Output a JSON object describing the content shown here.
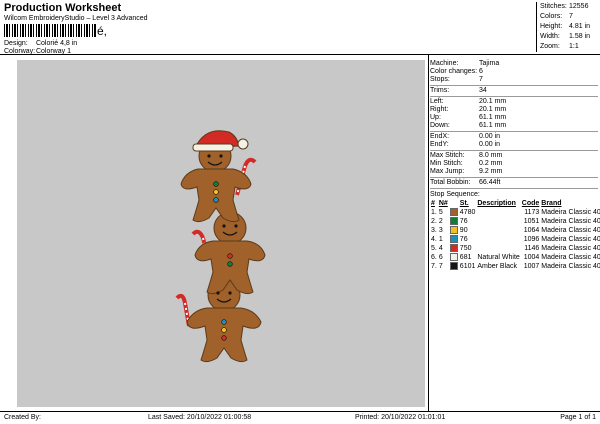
{
  "header": {
    "title": "Production Worksheet",
    "subtitle": "Wilcom EmbroideryStudio – Level 3 Advanced",
    "barcode_tail": "é,",
    "design_label": "Design:",
    "design_value": "Colorié 4,8 in",
    "colorway_label": "Colorway:",
    "colorway_value": "Colorway 1"
  },
  "stats": [
    {
      "k": "Stitches:",
      "v": "12556"
    },
    {
      "k": "Colors:",
      "v": "7"
    },
    {
      "k": "Height:",
      "v": "4.81 in"
    },
    {
      "k": "Width:",
      "v": "1.58 in"
    },
    {
      "k": "Zoom:",
      "v": "1:1"
    }
  ],
  "machine_info": [
    {
      "k": "Machine:",
      "v": "Tajima"
    },
    {
      "k": "Color changes:",
      "v": "6"
    },
    {
      "k": "Stops:",
      "v": "7"
    },
    {
      "k": "Trims:",
      "v": "34"
    },
    {
      "k": "Left:",
      "v": "20.1 mm"
    },
    {
      "k": "Right:",
      "v": "20.1 mm"
    },
    {
      "k": "Up:",
      "v": "61.1 mm"
    },
    {
      "k": "Down:",
      "v": "61.1 mm"
    },
    {
      "k": "EndX:",
      "v": "0.00 in"
    },
    {
      "k": "EndY:",
      "v": "0.00 in"
    },
    {
      "k": "Max Stitch:",
      "v": "8.0 mm"
    },
    {
      "k": "Min Stitch:",
      "v": "0.2 mm"
    },
    {
      "k": "Max Jump:",
      "v": "9.2 mm"
    },
    {
      "k": "Total Bobbin:",
      "v": "66.44ft"
    }
  ],
  "stop_sequence": {
    "title": "Stop Sequence:",
    "headers": [
      "#",
      "N#",
      "",
      "St.",
      "Description",
      "Code",
      "Brand"
    ],
    "rows": [
      {
        "idx": "1.",
        "n": "5",
        "num": "4780",
        "st": "",
        "desc": "",
        "code": "1173",
        "brand": "Madeira Classic 40",
        "color": "#a0612b"
      },
      {
        "idx": "2.",
        "n": "2",
        "num": "76",
        "st": "",
        "desc": "",
        "code": "1051",
        "brand": "Madeira Classic 40",
        "color": "#0f7d3a"
      },
      {
        "idx": "3.",
        "n": "3",
        "num": "90",
        "st": "",
        "desc": "",
        "code": "1064",
        "brand": "Madeira Classic 40",
        "color": "#f1c21c"
      },
      {
        "idx": "4.",
        "n": "1",
        "num": "76",
        "st": "",
        "desc": "",
        "code": "1096",
        "brand": "Madeira Classic 40",
        "color": "#1e8fb5"
      },
      {
        "idx": "5.",
        "n": "4",
        "num": "750",
        "st": "",
        "desc": "",
        "code": "1146",
        "brand": "Madeira Classic 40",
        "color": "#d22a25"
      },
      {
        "idx": "6.",
        "n": "6",
        "num": "681",
        "st": "",
        "desc": "Natural White",
        "code": "1004",
        "brand": "Madeira Classic 40",
        "color": "#f4f1e6"
      },
      {
        "idx": "7.",
        "n": "7",
        "num": "6101",
        "st": "",
        "desc": "Amber Black",
        "code": "1007",
        "brand": "Madeira Classic 40",
        "color": "#141414"
      }
    ]
  },
  "footer": {
    "created": "Created By:",
    "saved": "Last Saved: 20/10/2022 01:00:58",
    "printed": "Printed: 20/10/2022 01:01:01",
    "page": "Page 1 of 1"
  }
}
